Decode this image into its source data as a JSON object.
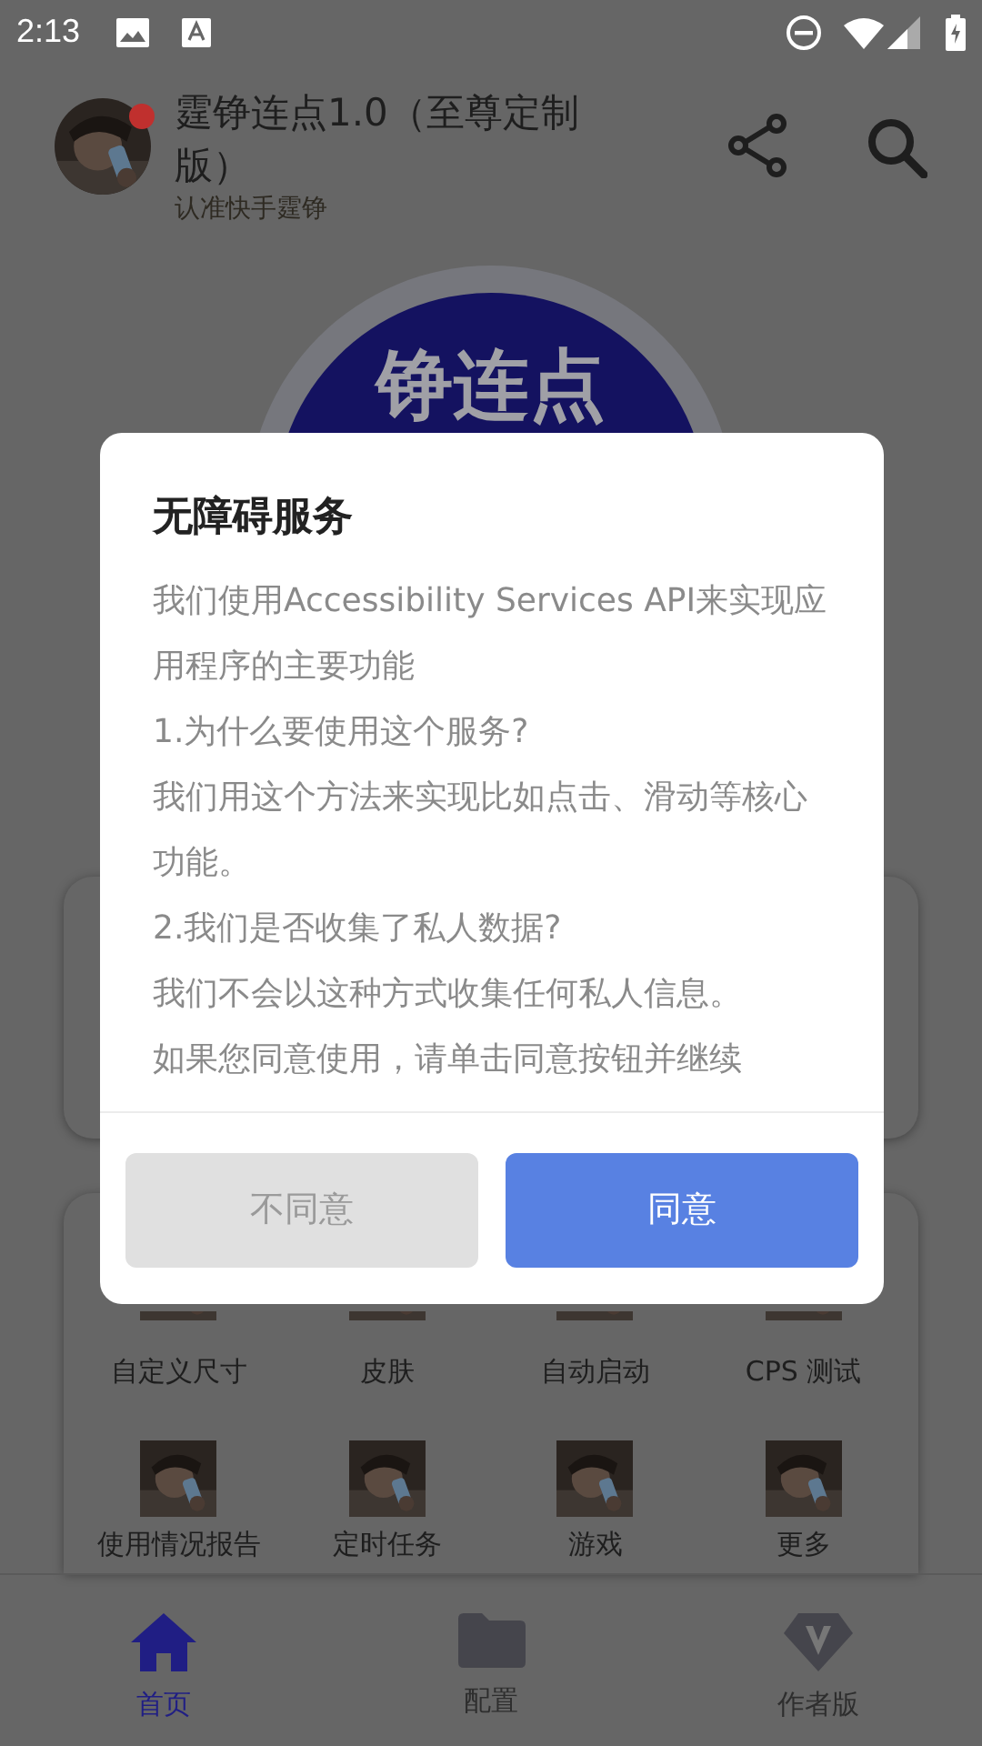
{
  "status_bar": {
    "time": "2:13"
  },
  "header": {
    "title": "霆铮连点1.0（至尊定制版）",
    "subtitle": "认准快手霆铮",
    "notification_dot": true
  },
  "hero": {
    "label": "铮连点"
  },
  "features": [
    {
      "label": "自定义尺寸"
    },
    {
      "label": "皮肤"
    },
    {
      "label": "自动启动"
    },
    {
      "label": "CPS 测试"
    },
    {
      "label": "使用情况报告"
    },
    {
      "label": "定时任务"
    },
    {
      "label": "游戏"
    },
    {
      "label": "更多"
    }
  ],
  "tab_bar": [
    {
      "label": "首页",
      "kind": "home",
      "selected": true
    },
    {
      "label": "配置",
      "kind": "folder",
      "selected": false
    },
    {
      "label": "作者版",
      "kind": "diamond",
      "selected": false
    }
  ],
  "dialog": {
    "title": "无障碍服务",
    "paragraphs": [
      "我们使用Accessibility Services API来实现应用程序的主要功能",
      "1.为什么要使用这个服务?",
      "我们用这个方法来实现比如点击、滑动等核心功能。",
      "2.我们是否收集了私人数据?",
      "我们不会以这种方式收集任何私人信息。",
      "如果您同意使用，请单击同意按钮并继续"
    ],
    "buttons": [
      {
        "label": "不同意",
        "kind": "secondary"
      },
      {
        "label": "同意",
        "kind": "primary"
      }
    ]
  }
}
